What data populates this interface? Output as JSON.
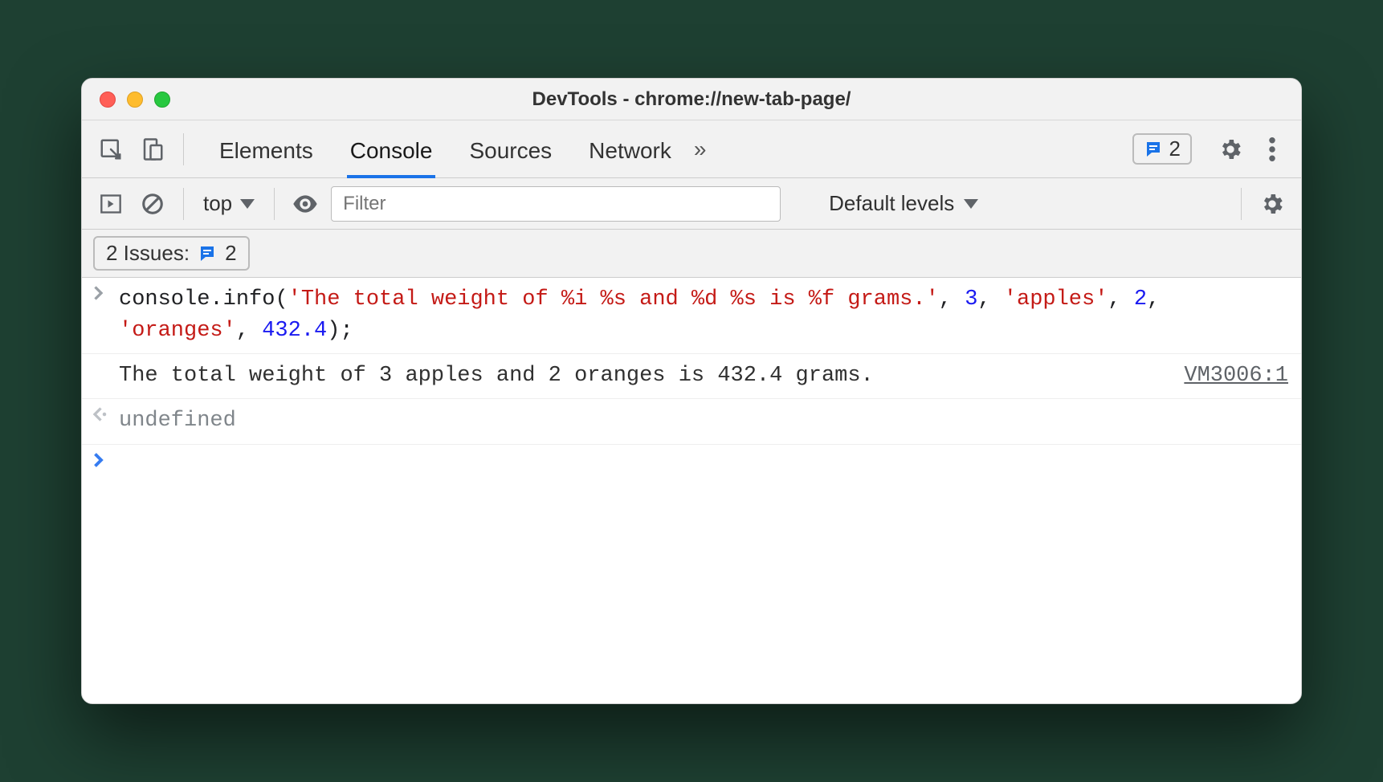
{
  "window": {
    "title": "DevTools - chrome://new-tab-page/"
  },
  "tabs": {
    "items": [
      "Elements",
      "Console",
      "Sources",
      "Network"
    ],
    "active": "Console",
    "more_glyph": "»"
  },
  "issues_badge": {
    "count": "2"
  },
  "subbar": {
    "context": "top",
    "filter_placeholder": "Filter",
    "levels": "Default levels"
  },
  "issues_row": {
    "label": "2 Issues:",
    "count": "2"
  },
  "console": {
    "input": {
      "tokens": [
        {
          "t": "obj",
          "v": "console"
        },
        {
          "t": "punct",
          "v": "."
        },
        {
          "t": "prop",
          "v": "info"
        },
        {
          "t": "punct",
          "v": "("
        },
        {
          "t": "str",
          "v": "'The total weight of %i %s and %d %s is %f grams.'"
        },
        {
          "t": "punct",
          "v": ", "
        },
        {
          "t": "num",
          "v": "3"
        },
        {
          "t": "punct",
          "v": ", "
        },
        {
          "t": "str",
          "v": "'apples'"
        },
        {
          "t": "punct",
          "v": ", "
        },
        {
          "t": "num",
          "v": "2"
        },
        {
          "t": "punct",
          "v": ", "
        },
        {
          "t": "str",
          "v": "'oranges'"
        },
        {
          "t": "punct",
          "v": ", "
        },
        {
          "t": "num",
          "v": "432.4"
        },
        {
          "t": "punct",
          "v": ");"
        }
      ]
    },
    "output": {
      "text": "The total weight of 3 apples and 2 oranges is 432.4 grams.",
      "source": "VM3006:1"
    },
    "return": "undefined"
  }
}
